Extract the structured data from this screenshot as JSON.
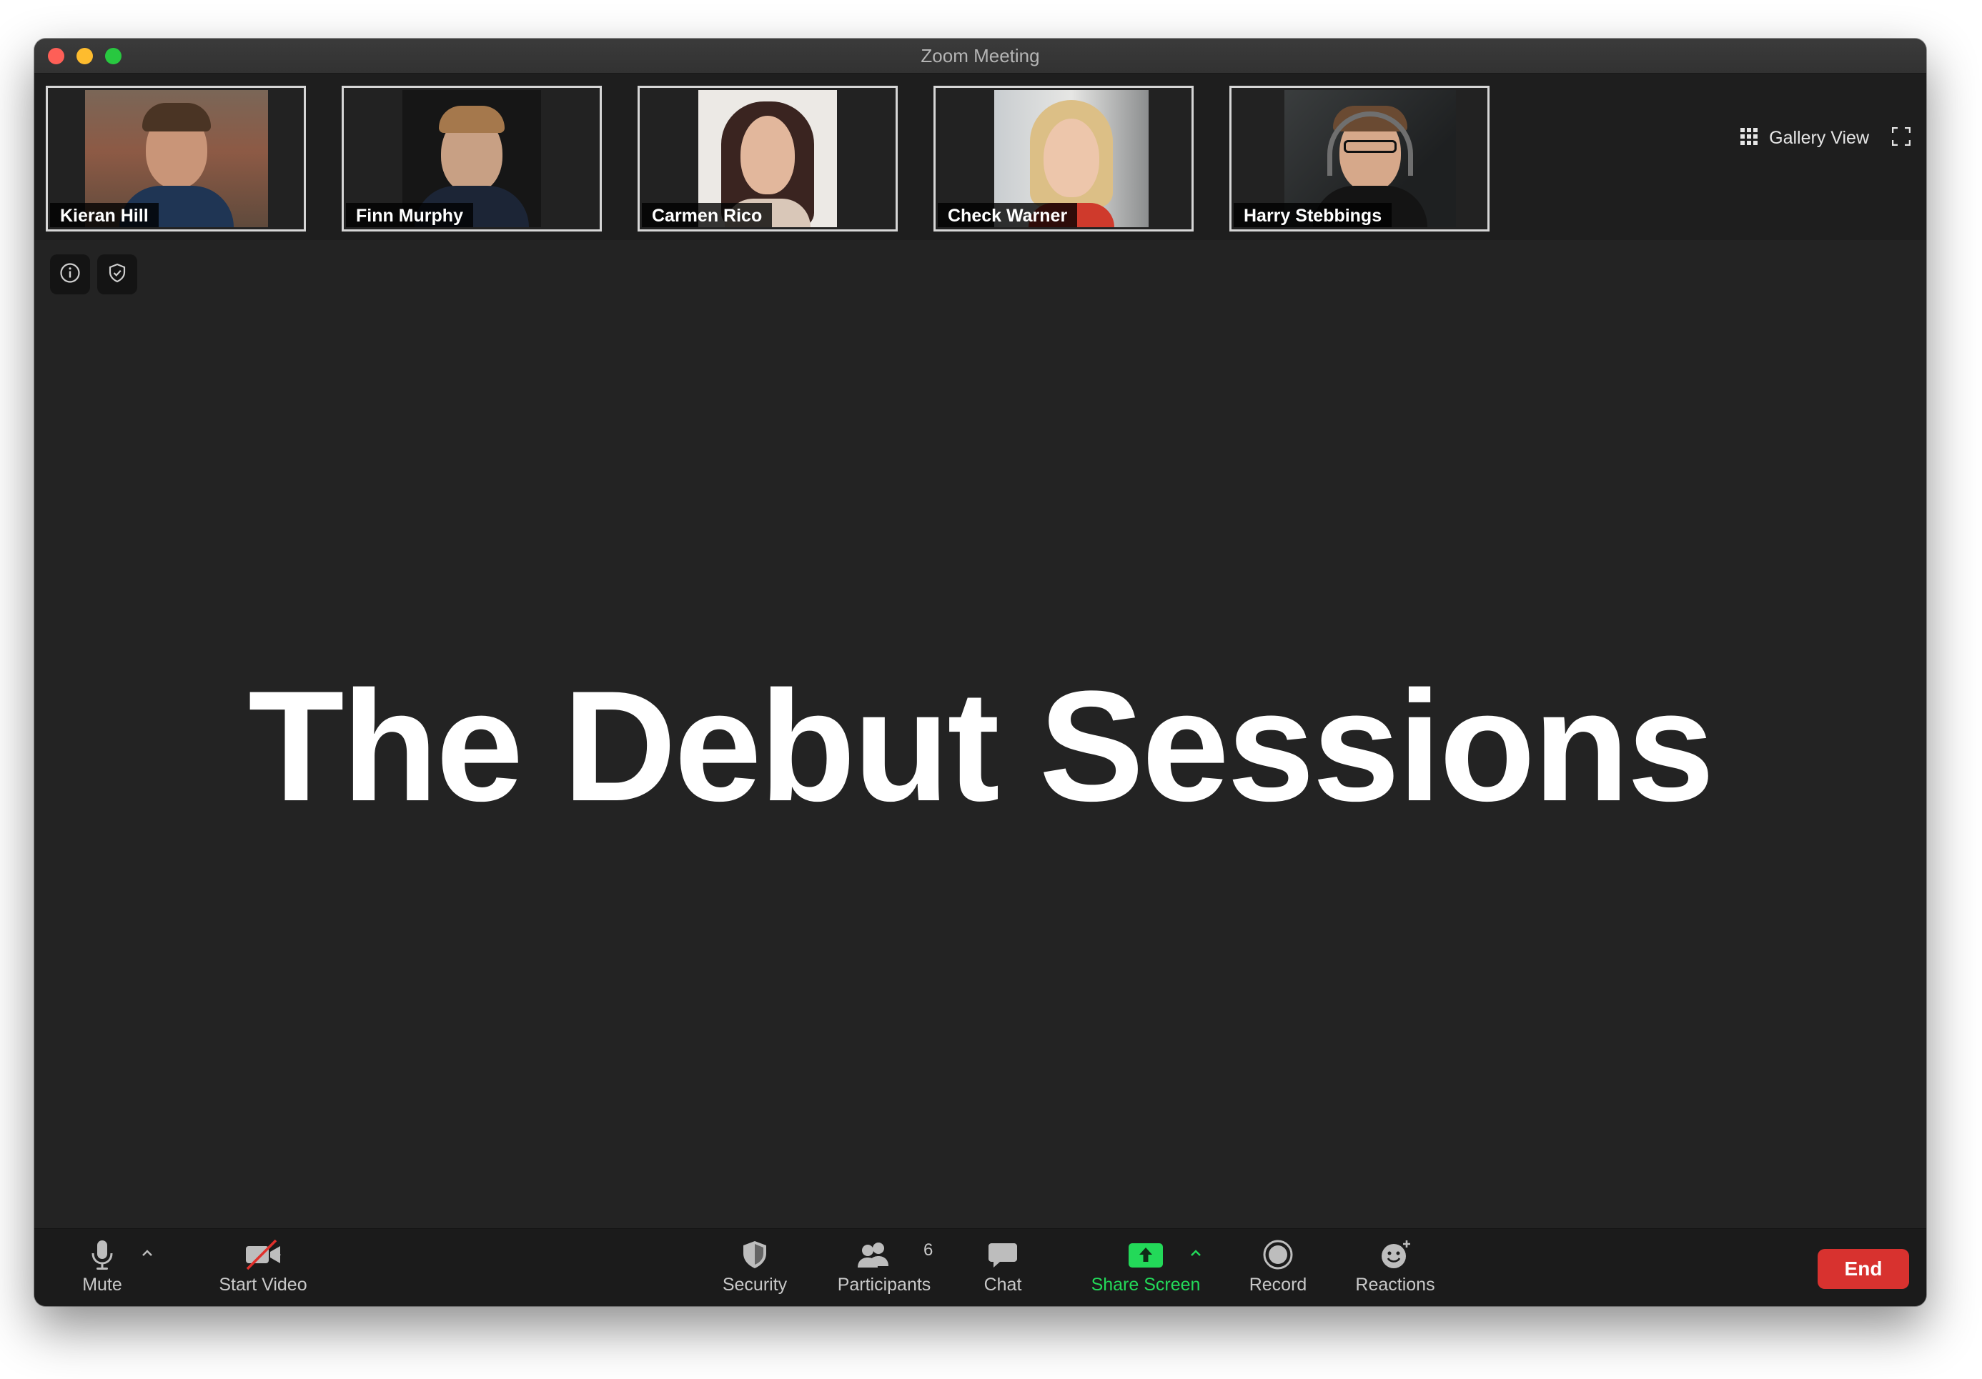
{
  "window": {
    "title": "Zoom Meeting"
  },
  "participants": [
    {
      "name": "Kieran Hill"
    },
    {
      "name": "Finn Murphy"
    },
    {
      "name": "Carmen Rico"
    },
    {
      "name": "Check Warner"
    },
    {
      "name": "Harry Stebbings"
    }
  ],
  "view_controls": {
    "gallery_label": "Gallery View",
    "gallery_icon": "grid-icon",
    "fullscreen_icon": "fullscreen-icon"
  },
  "meeting_info": {
    "info_icon": "info-icon",
    "security_icon": "shield-check-icon"
  },
  "shared_content": {
    "title": "The Debut Sessions"
  },
  "toolbar": {
    "mute_label": "Mute",
    "start_video_label": "Start Video",
    "security_label": "Security",
    "participants_label": "Participants",
    "participants_count": "6",
    "chat_label": "Chat",
    "share_screen_label": "Share Screen",
    "record_label": "Record",
    "reactions_label": "Reactions",
    "end_label": "End"
  },
  "colors": {
    "window_bg": "#232323",
    "toolbar_bg": "#1b1b1b",
    "share_green": "#23d959",
    "end_red": "#d8322f",
    "video_off_red": "#e0302b"
  }
}
